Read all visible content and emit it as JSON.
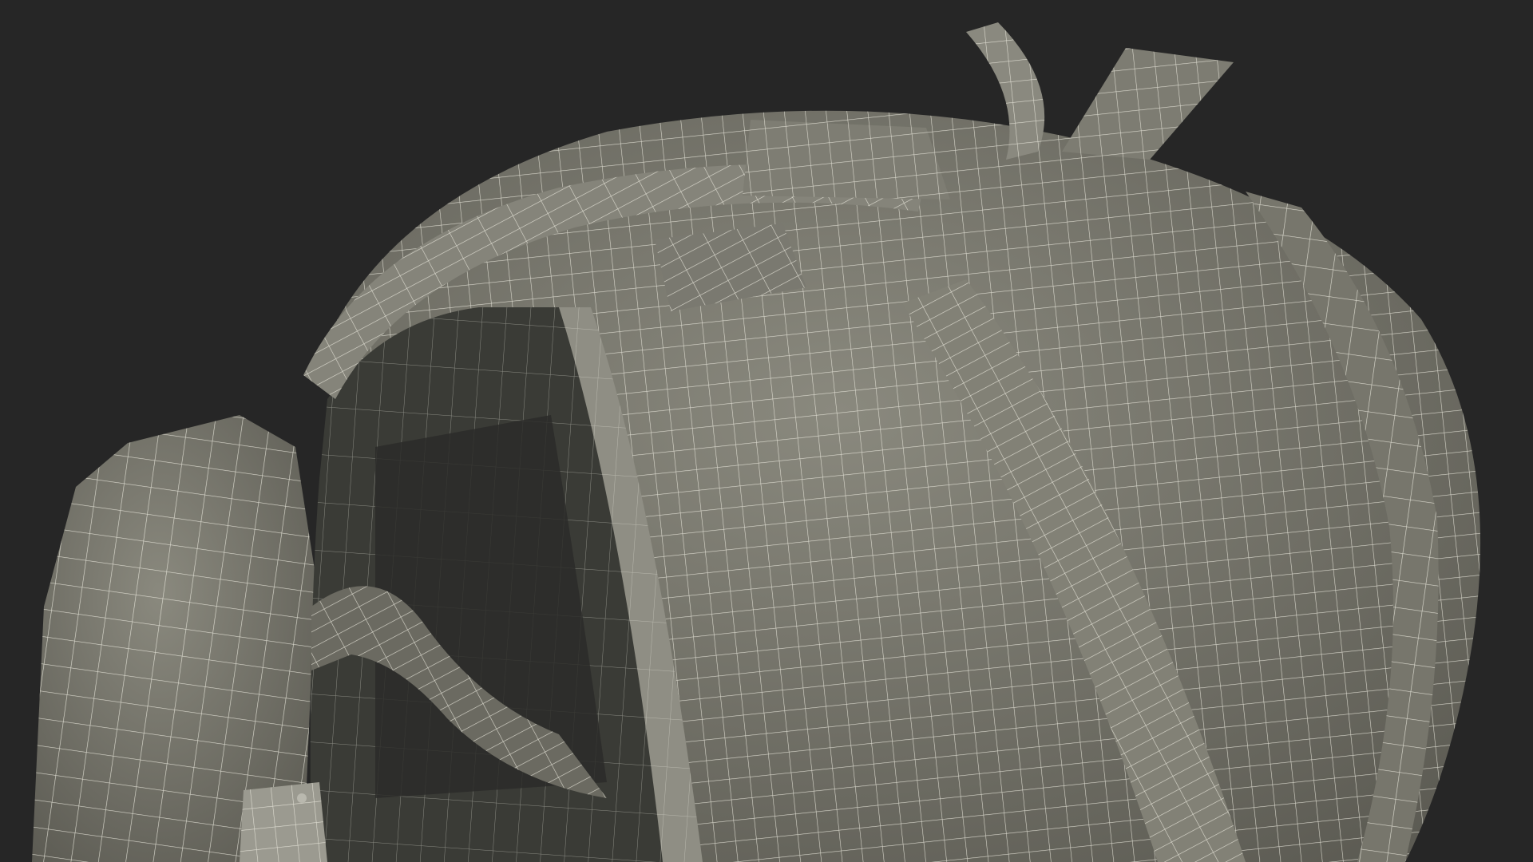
{
  "scene": {
    "subject": "helmet-wireframe-render",
    "colors": {
      "background": "#262626",
      "surface": "#7b7a6f",
      "surface_dark": "#5f5e55",
      "interior": "#3a3b36",
      "interior_deep": "#2b2c29",
      "wire": "#ecebe0"
    }
  }
}
